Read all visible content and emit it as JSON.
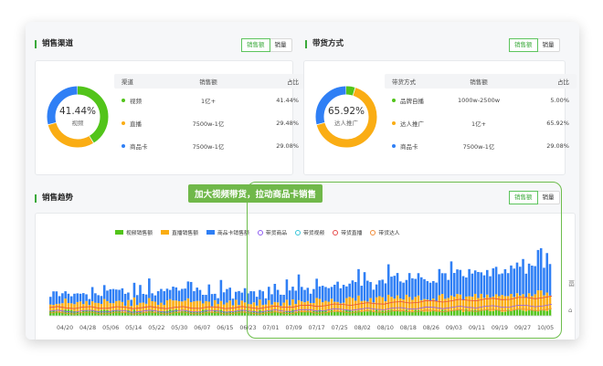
{
  "sales_channel": {
    "title": "销售渠道",
    "toggle": {
      "active": "销售额",
      "other": "销量"
    },
    "donut": {
      "pct": "41.44%",
      "label": "视频",
      "segments": [
        41.44,
        29.48,
        29.08
      ],
      "colors": [
        "#52c41a",
        "#faad14",
        "#2f7ff5"
      ]
    },
    "table": {
      "headers": [
        "渠道",
        "销售额",
        "占比"
      ],
      "rows": [
        {
          "name": "视频",
          "sales": "1亿+",
          "share": "41.44%",
          "color": "#52c41a"
        },
        {
          "name": "直播",
          "sales": "7500w-1亿",
          "share": "29.48%",
          "color": "#faad14"
        },
        {
          "name": "商品卡",
          "sales": "7500w-1亿",
          "share": "29.08%",
          "color": "#2f7ff5"
        }
      ]
    }
  },
  "selling_method": {
    "title": "带货方式",
    "toggle": {
      "active": "销售额",
      "other": "销量"
    },
    "donut": {
      "pct": "65.92%",
      "label": "达人推广",
      "segments": [
        5.0,
        65.92,
        29.08
      ],
      "colors": [
        "#52c41a",
        "#faad14",
        "#2f7ff5"
      ]
    },
    "table": {
      "headers": [
        "带货方式",
        "销售额",
        "占比"
      ],
      "rows": [
        {
          "name": "品牌自播",
          "sales": "1000w-2500w",
          "share": "5.00%",
          "color": "#52c41a"
        },
        {
          "name": "达人推广",
          "sales": "1亿+",
          "share": "65.92%",
          "color": "#faad14"
        },
        {
          "name": "商品卡",
          "sales": "7500w-1亿",
          "share": "29.08%",
          "color": "#2f7ff5"
        }
      ]
    }
  },
  "sales_trend": {
    "title": "销售趋势",
    "toggle": {
      "active": "销售额",
      "other": "销量"
    },
    "callout": "加大视频带货，拉动商品卡销售",
    "legend": [
      {
        "label": "视频销售额",
        "kind": "bar",
        "color": "#52c41a"
      },
      {
        "label": "直播销售额",
        "kind": "bar",
        "color": "#faad14"
      },
      {
        "label": "商品卡销售额",
        "kind": "bar",
        "color": "#2f7ff5"
      },
      {
        "label": "带货商品",
        "kind": "line",
        "color": "#8e5cf2"
      },
      {
        "label": "带货视频",
        "kind": "line",
        "color": "#36c5d9"
      },
      {
        "label": "带货直播",
        "kind": "line",
        "color": "#e64a4a"
      },
      {
        "label": "带货达人",
        "kind": "line",
        "color": "#f08c38"
      }
    ],
    "x_ticks": [
      "04/20",
      "04/28",
      "05/06",
      "05/14",
      "05/22",
      "05/30",
      "06/07",
      "06/15",
      "06/23",
      "07/01",
      "07/09",
      "07/17",
      "07/25",
      "08/02",
      "08/10",
      "08/18",
      "08/26",
      "09/03",
      "09/11",
      "09/19",
      "09/27",
      "10/05"
    ],
    "edge_labels": [
      "畐",
      "⌂"
    ]
  },
  "chart_data": {
    "type": "bar",
    "series": [
      {
        "name": "视频销售额",
        "color": "#52c41a"
      },
      {
        "name": "直播销售额",
        "color": "#faad14"
      },
      {
        "name": "商品卡销售额",
        "color": "#2f7ff5"
      },
      {
        "name": "带货商品",
        "color": "#8e5cf2"
      },
      {
        "name": "带货视频",
        "color": "#36c5d9"
      },
      {
        "name": "带货直播",
        "color": "#e64a4a"
      },
      {
        "name": "带货达人",
        "color": "#f08c38"
      }
    ],
    "categories": [
      "04/20",
      "04/28",
      "05/06",
      "05/14",
      "05/22",
      "05/30",
      "06/07",
      "06/15",
      "06/23",
      "07/01",
      "07/09",
      "07/17",
      "07/25",
      "08/02",
      "08/10",
      "08/18",
      "08/26",
      "09/03",
      "09/11",
      "09/19",
      "09/27",
      "10/05"
    ],
    "legend_position": "top",
    "grid": false
  }
}
